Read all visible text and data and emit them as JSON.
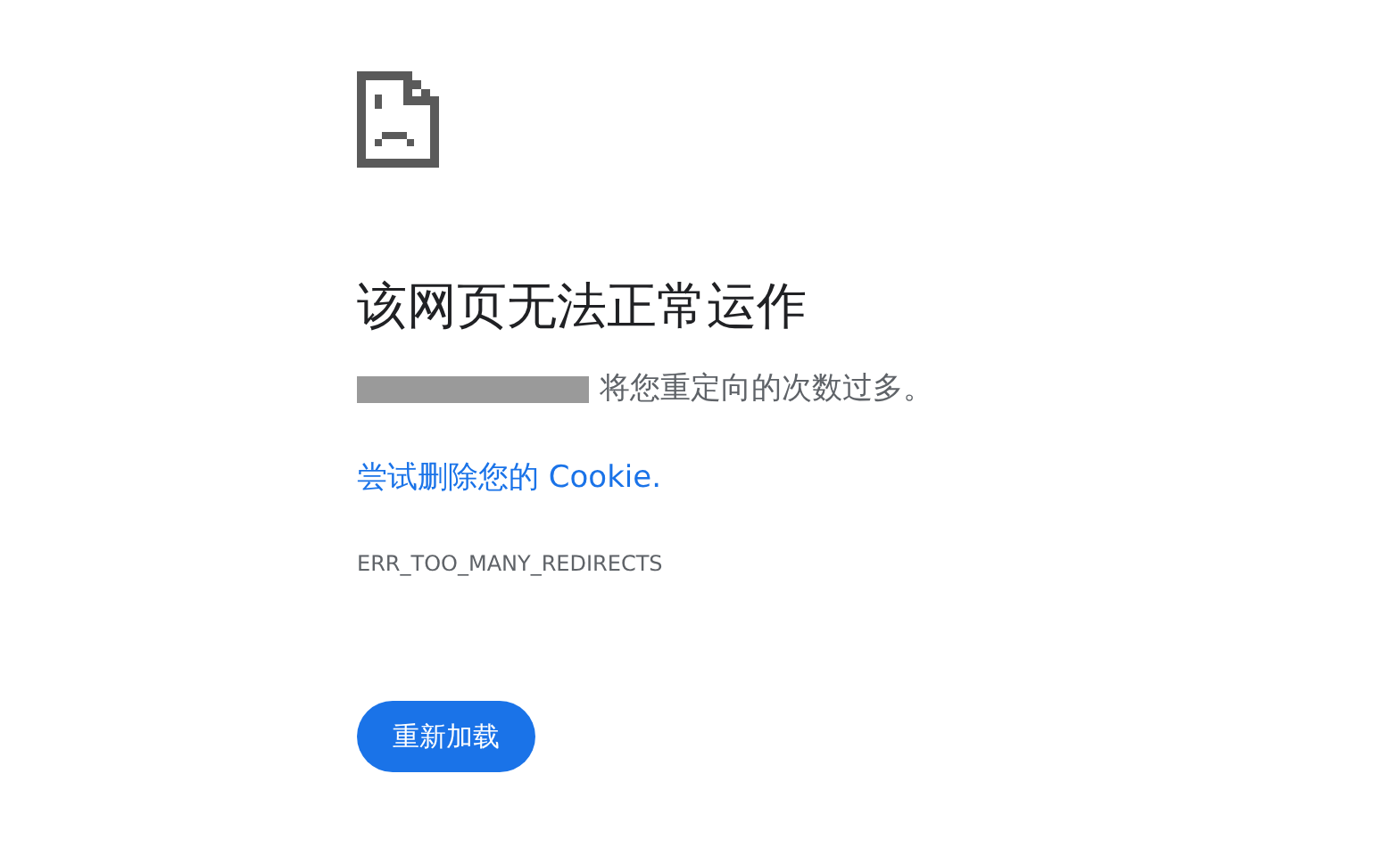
{
  "heading": "该网页无法正常运作",
  "message": "将您重定向的次数过多。",
  "link": "尝试删除您的 Cookie.",
  "error_code": "ERR_TOO_MANY_REDIRECTS",
  "button": "重新加载"
}
